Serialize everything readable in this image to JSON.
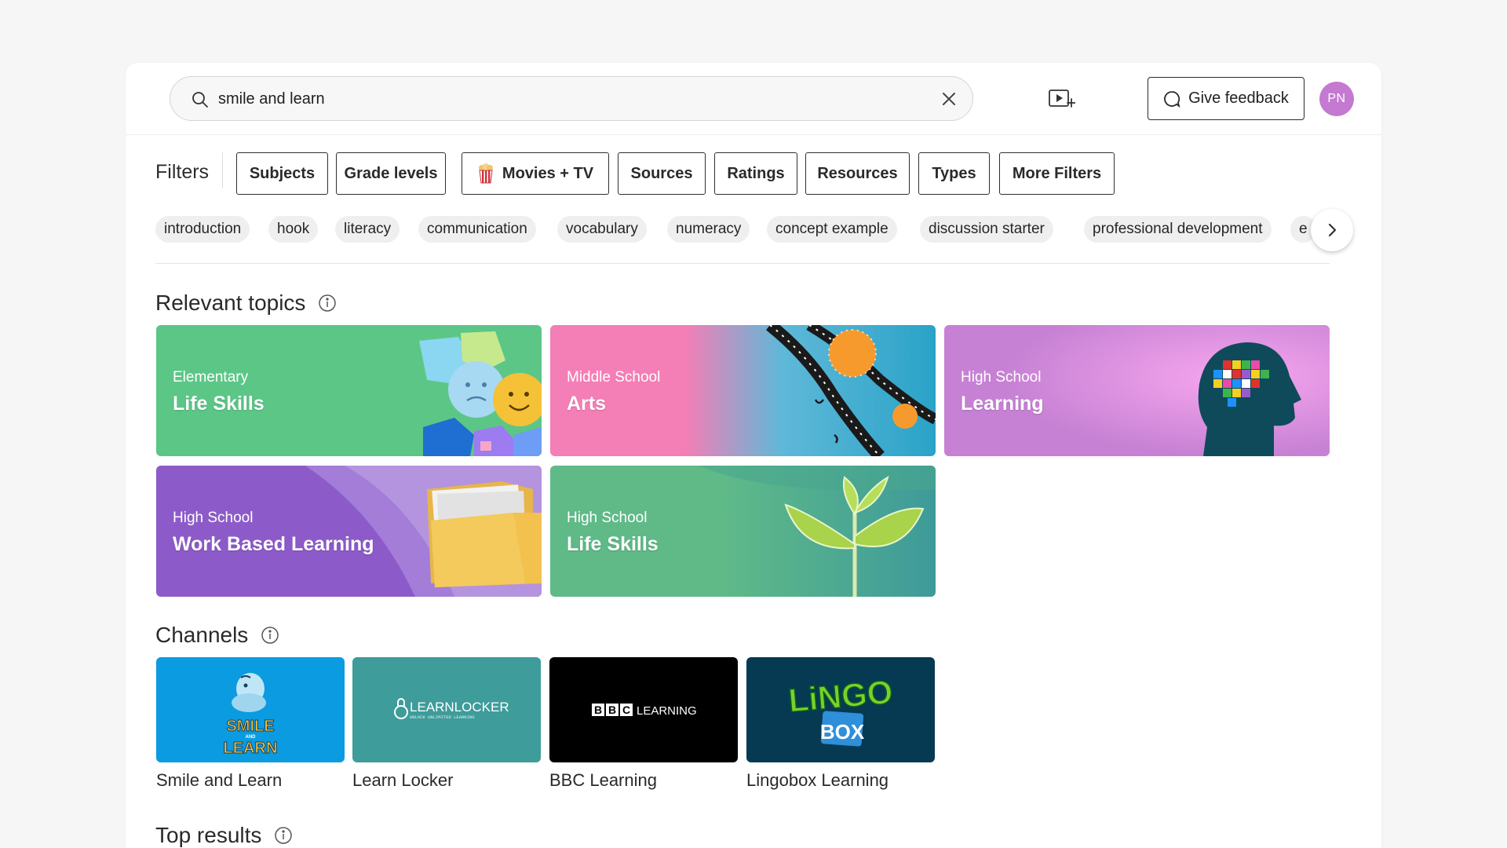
{
  "search": {
    "value": "smile and learn",
    "placeholder": "Search"
  },
  "header": {
    "feedback_label": "Give feedback",
    "avatar_initials": "PN"
  },
  "filters": {
    "label": "Filters",
    "buttons": [
      "Subjects",
      "Grade levels",
      "Movies + TV",
      "Sources",
      "Ratings",
      "Resources",
      "Types",
      "More Filters"
    ]
  },
  "chips": [
    "introduction",
    "hook",
    "literacy",
    "communication",
    "vocabulary",
    "numeracy",
    "concept example",
    "discussion starter",
    "professional development",
    "e"
  ],
  "relevant_topics": {
    "title": "Relevant topics",
    "tiles": [
      {
        "grade": "Elementary",
        "name": "Life Skills",
        "color": "#5cc687"
      },
      {
        "grade": "Middle School",
        "name": "Arts",
        "color": "#f47eb6"
      },
      {
        "grade": "High School",
        "name": "Learning",
        "color": "#c681d4"
      },
      {
        "grade": "High School",
        "name": "Work Based Learning",
        "color": "#8d5bc9"
      },
      {
        "grade": "High School",
        "name": "Life Skills",
        "color": "#5fba88"
      }
    ]
  },
  "channels": {
    "title": "Channels",
    "items": [
      {
        "name": "Smile and Learn",
        "logo_text": [
          "SMILE",
          "AND",
          "LEARN"
        ],
        "color": "#0a9be0"
      },
      {
        "name": "Learn Locker",
        "logo_text": [
          "LEARNLOCKER",
          "UNLOCK UNLIMITED LEARNING"
        ],
        "color": "#3e9c9b"
      },
      {
        "name": "BBC Learning",
        "logo_text": [
          "B",
          "B",
          "C",
          "LEARNING"
        ],
        "color": "#000000"
      },
      {
        "name": "Lingobox Learning",
        "logo_text": [
          "LiNGO",
          "BOX"
        ],
        "color": "#063a52"
      }
    ]
  },
  "top_results": {
    "title": "Top results"
  }
}
